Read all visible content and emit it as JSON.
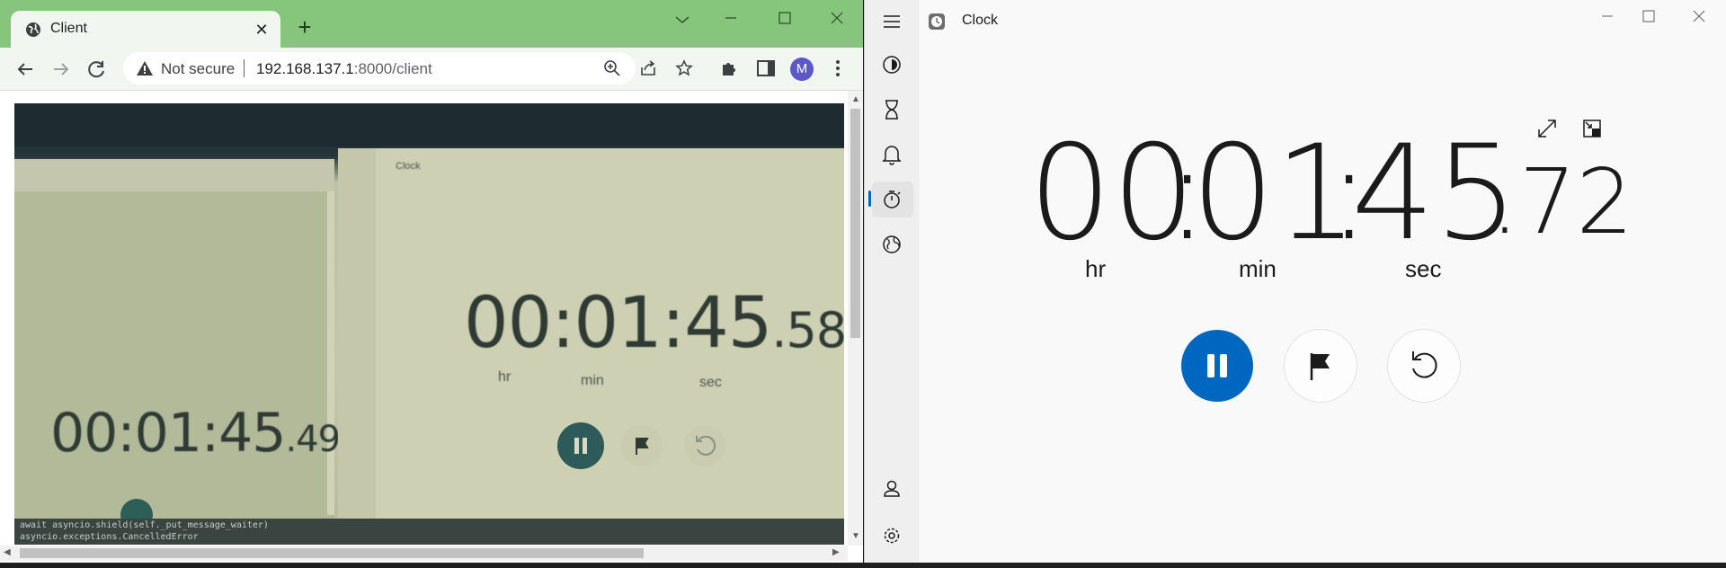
{
  "chrome": {
    "tab_title": "Client",
    "security_label": "Not secure",
    "url_host": "192.168.137.1",
    "url_rest": ":8000/client",
    "avatar_letter": "M",
    "camera": {
      "back_time_main": "00:01:45",
      "back_time_frac": ".49",
      "front_time_main": "00:01:45",
      "front_time_frac": ".58",
      "front_units": [
        "hr",
        "min",
        "sec"
      ],
      "front_app_title": "Clock",
      "terminal_lines": [
        "await asyncio.shield(self._put_message_waiter)",
        "asyncio.exceptions.CancelledError"
      ]
    }
  },
  "clock": {
    "app_title": "Clock",
    "hours": "00",
    "minutes": "01",
    "seconds": "45",
    "fraction": ".72",
    "units": {
      "hr": "hr",
      "min": "min",
      "sec": "sec"
    },
    "colors": {
      "accent": "#0067c0",
      "background": "#f9f9f9",
      "rail": "#efefef"
    },
    "rail_icons": [
      "menu-icon",
      "focus-sessions-icon",
      "timer-icon",
      "alarm-icon",
      "stopwatch-icon",
      "world-clock-icon",
      "account-icon",
      "settings-icon"
    ],
    "controls": [
      "pause-button",
      "lap-button",
      "reset-button"
    ]
  }
}
